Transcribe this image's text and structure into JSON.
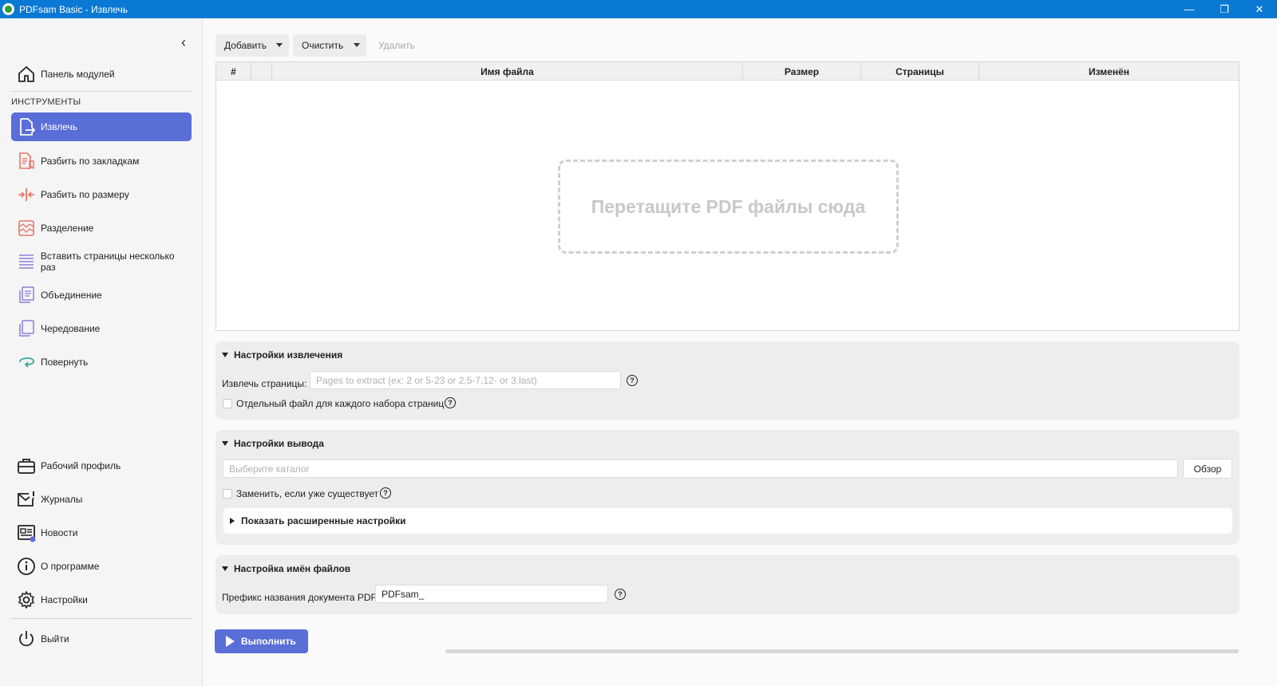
{
  "window": {
    "title": "PDFsam Basic - Извлечь",
    "minimize": "—",
    "restore": "❐",
    "close": "✕"
  },
  "sidebar": {
    "dashboard": "Панель модулей",
    "section_tools": "ИНСТРУМЕНТЫ",
    "tools": [
      {
        "label": "Извлечь",
        "icon": "extract-icon",
        "active": true
      },
      {
        "label": "Разбить по закладкам",
        "icon": "split-bookmarks-icon"
      },
      {
        "label": "Разбить по размеру",
        "icon": "split-size-icon"
      },
      {
        "label": "Разделение",
        "icon": "split-icon"
      },
      {
        "label": "Вставить страницы несколько раз",
        "icon": "insert-pages-icon"
      },
      {
        "label": "Объединение",
        "icon": "merge-icon"
      },
      {
        "label": "Чередование",
        "icon": "alternate-mix-icon"
      },
      {
        "label": "Повернуть",
        "icon": "rotate-icon"
      }
    ],
    "bottom": [
      {
        "label": "Рабочий профиль",
        "icon": "briefcase-icon"
      },
      {
        "label": "Журналы",
        "icon": "logs-icon"
      },
      {
        "label": "Новости",
        "icon": "news-icon"
      },
      {
        "label": "О программе",
        "icon": "info-icon"
      },
      {
        "label": "Настройки",
        "icon": "gear-icon"
      }
    ],
    "exit": "Выйти",
    "accent_color": "#5a6ed8"
  },
  "toolbar": {
    "add": "Добавить",
    "clear": "Очистить",
    "remove": "Удалить"
  },
  "table": {
    "columns": [
      "#",
      "",
      "Имя файла",
      "Размер",
      "Страницы",
      "Изменён"
    ],
    "drop_hint": "Перетащите PDF файлы сюда"
  },
  "extract_settings": {
    "title": "Настройки извлечения",
    "pages_label": "Извлечь страницы:",
    "pages_placeholder": "Pages to extract (ex: 2 or 5-23 or 2,5-7,12- or 3,last)",
    "separate_file_label": "Отдельный файл для каждого набора страниц"
  },
  "output_settings": {
    "title": "Настройки вывода",
    "dir_placeholder": "Выберите каталог",
    "browse": "Обзор",
    "overwrite_label": "Заменить, если уже существует",
    "advanced": "Показать расширенные настройки"
  },
  "naming_settings": {
    "title": "Настройка имён файлов",
    "prefix_label": "Префикс названия документа PDF:",
    "prefix_value": "PDFsam_"
  },
  "run": {
    "label": "Выполнить"
  }
}
